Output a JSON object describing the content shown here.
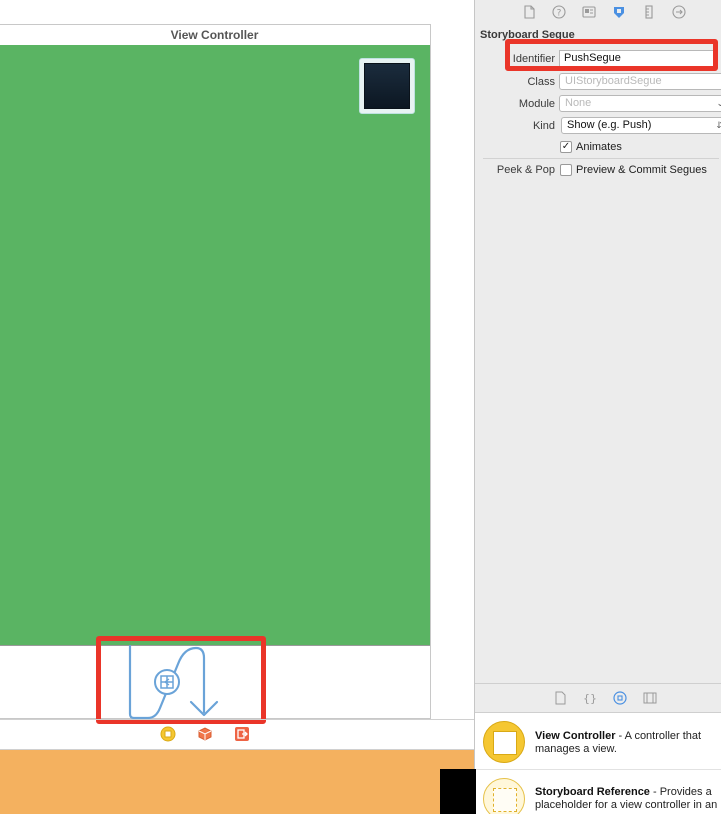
{
  "canvas": {
    "scene_title": "View Controller"
  },
  "inspector": {
    "tabs": [
      "file-icon",
      "help-icon",
      "identity-icon",
      "attributes-icon",
      "size-icon",
      "connections-icon"
    ],
    "section_title": "Storyboard Segue",
    "identifier": {
      "label": "Identifier",
      "value": "PushSegue"
    },
    "class": {
      "label": "Class",
      "placeholder": "UIStoryboardSegue"
    },
    "module": {
      "label": "Module",
      "placeholder": "None"
    },
    "kind": {
      "label": "Kind",
      "value": "Show (e.g. Push)"
    },
    "animates": {
      "label": "Animates",
      "checked": true
    },
    "peek_pop": {
      "label": "Peek & Pop",
      "option_label": "Preview & Commit Segues",
      "checked": false
    }
  },
  "library": {
    "tabs": [
      "file-template-icon",
      "code-snippet-icon",
      "object-icon",
      "media-icon"
    ],
    "items": [
      {
        "name": "View Controller",
        "description": " - A controller that manages a view."
      },
      {
        "name": "Storyboard Reference",
        "description": " - Provides a placeholder for a view controller in an"
      }
    ]
  },
  "colors": {
    "view_background": "#5ab463",
    "highlight": "#ea3529",
    "segue_line": "#6aa3d8",
    "bottom_bar": "#f4b15f"
  }
}
